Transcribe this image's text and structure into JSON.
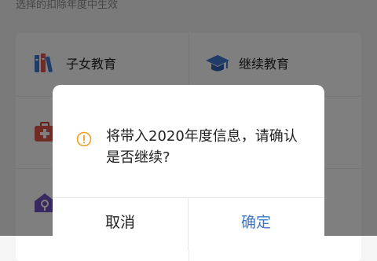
{
  "screen": {
    "subtitle": "选择的扣除年度中生效",
    "items": [
      {
        "label": "子女教育",
        "icon": "children-education-books-icon"
      },
      {
        "label": "继续教育",
        "icon": "graduation-cap-icon"
      },
      {
        "label": "",
        "icon": "medical-kit-icon"
      },
      {
        "label": "",
        "icon": "house-rent-icon"
      }
    ]
  },
  "dialog": {
    "message": "将带入2020年度信息，请确认是否继续?",
    "icon": "warning-info-icon",
    "cancel_label": "取消",
    "ok_label": "确定"
  },
  "colors": {
    "accent": "#3f76c4",
    "warning": "#f0a020",
    "overlay": "rgba(0,0,0,0.5)"
  }
}
